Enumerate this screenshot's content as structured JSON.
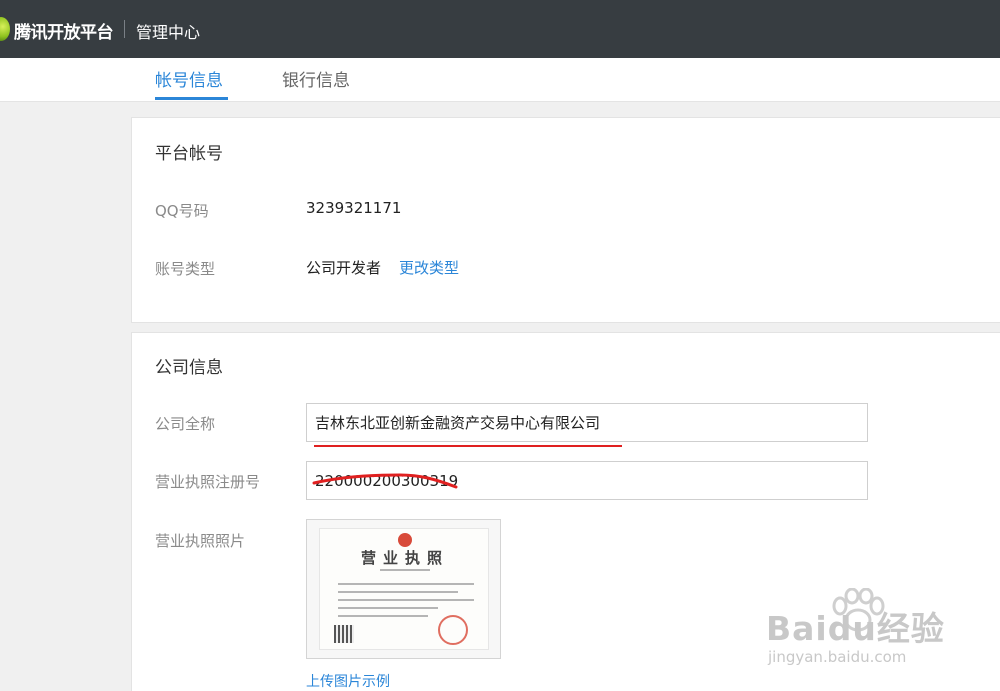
{
  "header": {
    "logo_text": "腾讯开放平台",
    "section": "管理中心"
  },
  "tabs": [
    {
      "label": "帐号信息",
      "active": true
    },
    {
      "label": "银行信息",
      "active": false
    }
  ],
  "platform_account": {
    "title": "平台帐号",
    "qq_label": "QQ号码",
    "qq_value": "3239321171",
    "type_label": "账号类型",
    "type_value": "公司开发者",
    "change_type_link": "更改类型"
  },
  "company_info": {
    "title": "公司信息",
    "name_label": "公司全称",
    "name_value": "吉林东北亚创新金融资产交易中心有限公司",
    "license_no_label": "营业执照注册号",
    "license_no_value": "220000200300319",
    "license_photo_label": "营业执照照片",
    "license_photo_title": "营业执照",
    "upload_example_link": "上传图片示例"
  },
  "watermark": {
    "logo_text": "Baidu经验",
    "url": "jingyan.baidu.com"
  },
  "colors": {
    "topbar": "#373d41",
    "accent": "#2b86d8",
    "redaction": "#e02020"
  }
}
